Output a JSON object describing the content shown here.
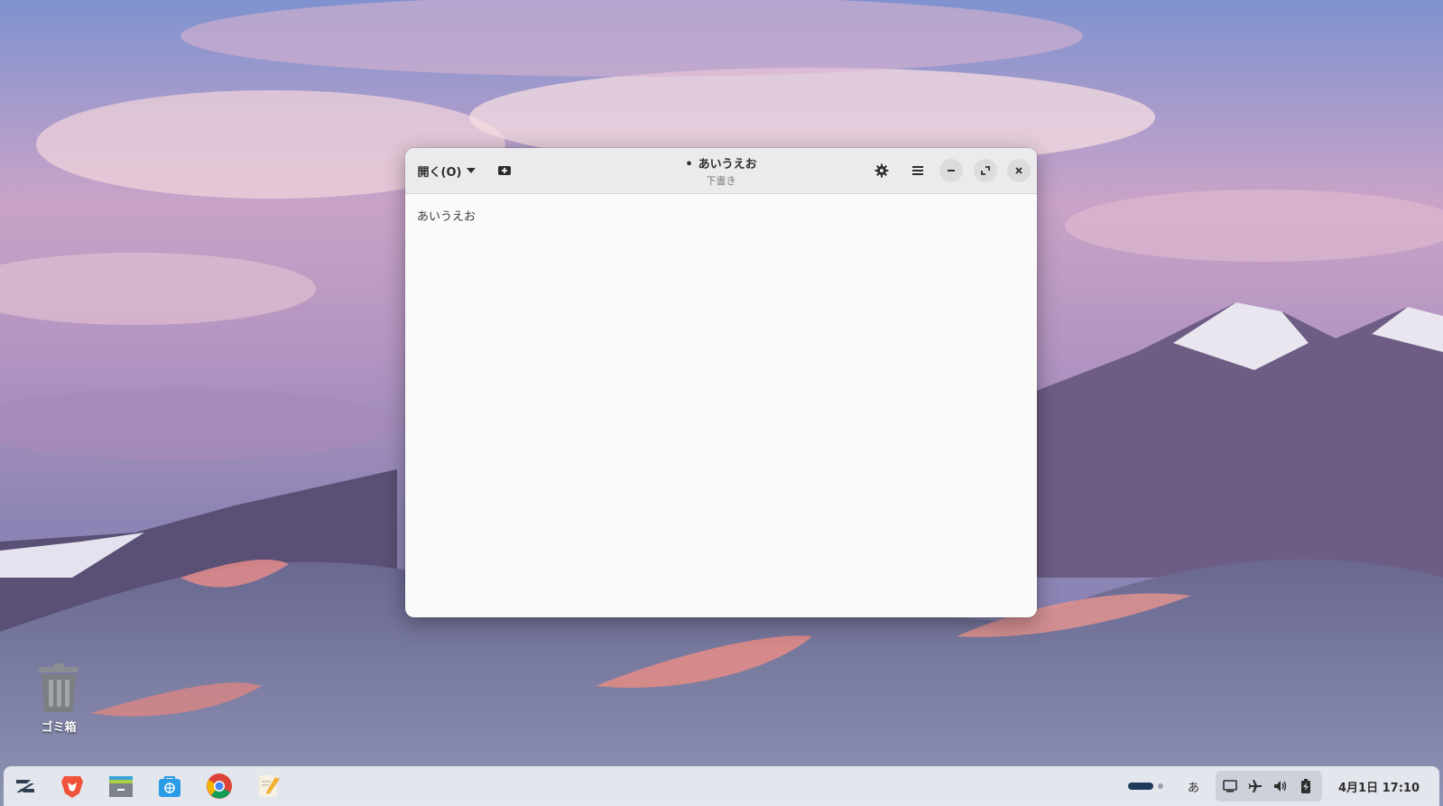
{
  "desktop": {
    "trash_label": "ゴミ箱"
  },
  "window": {
    "open_button_label": "開く(O)",
    "title": "あいうえお",
    "modified_dot": "•",
    "subtitle": "下書き",
    "editor_text": "あいうえお"
  },
  "taskbar": {
    "apps": [
      "zorin-menu-icon",
      "brave-browser-icon",
      "files-icon",
      "software-store-icon",
      "chrome-icon",
      "text-editor-icon"
    ],
    "ime_indicator": "あ",
    "clock": "4月1日  17:10"
  },
  "colors": {
    "headerbar": "#ebebed",
    "window_bg": "#fafafa",
    "taskbar": "#eceef2"
  }
}
